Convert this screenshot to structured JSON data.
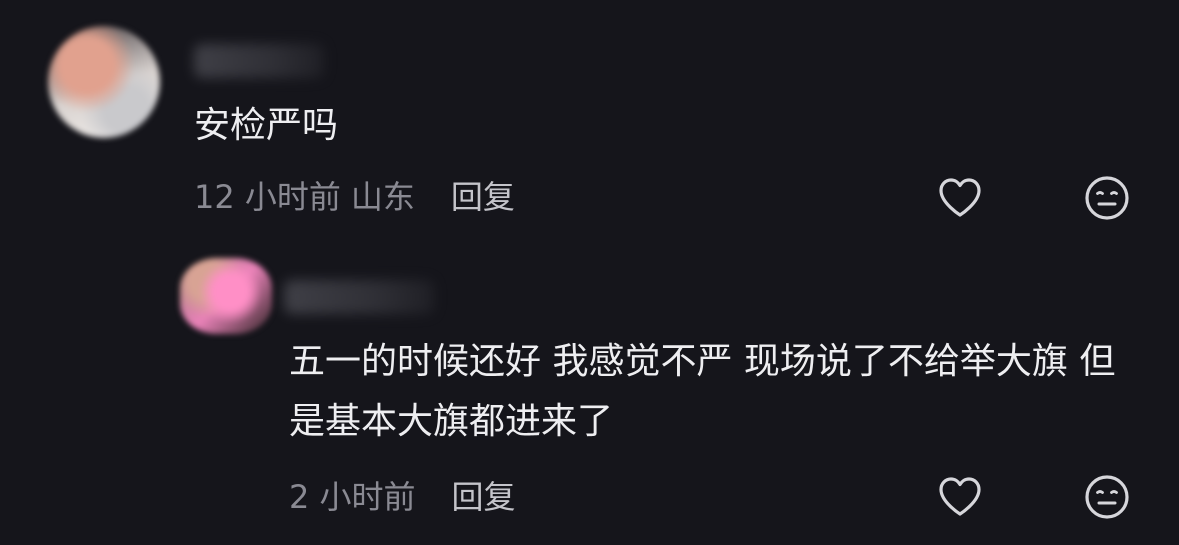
{
  "comments": [
    {
      "text": "安检严吗",
      "time": "12 小时前",
      "location": "山东",
      "reply_label": "回复",
      "like_icon": "heart-outline",
      "dislike_icon": "neutral-face"
    },
    {
      "text": "五一的时候还好 我感觉不严 现场说了不给举大旗 但是基本大旗都进来了",
      "time": "2 小时前",
      "reply_label": "回复",
      "like_icon": "heart-outline",
      "dislike_icon": "neutral-face"
    }
  ],
  "colors": {
    "background": "#15151b",
    "text": "#eeeef1",
    "meta": "#8a8a93",
    "icon": "#d6d6db"
  }
}
